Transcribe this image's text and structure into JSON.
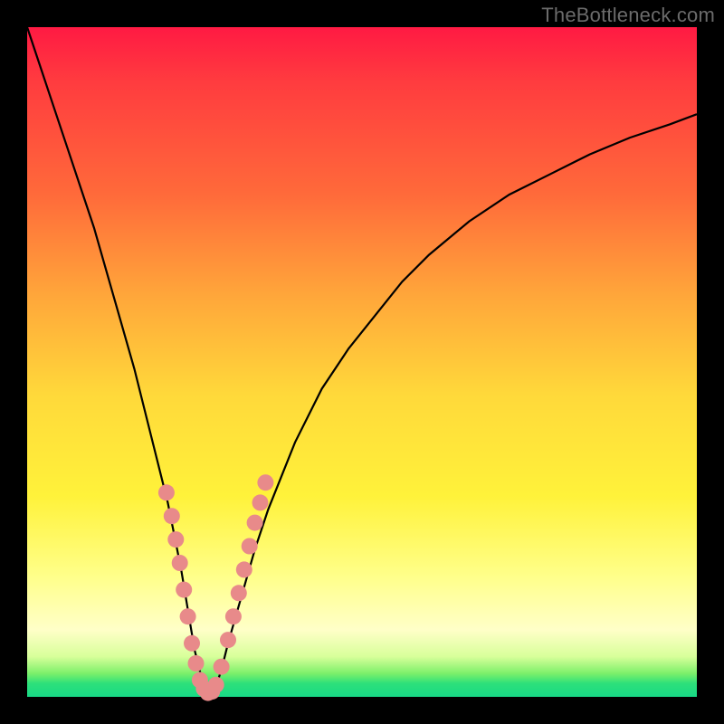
{
  "watermark": "TheBottleneck.com",
  "colors": {
    "frame": "#000000",
    "curve": "#000000",
    "marker_fill": "#e88a8a",
    "marker_stroke": "#d87575"
  },
  "chart_data": {
    "type": "line",
    "title": "",
    "xlabel": "",
    "ylabel": "",
    "xlim": [
      0,
      100
    ],
    "ylim": [
      0,
      100
    ],
    "series": [
      {
        "name": "bottleneck-curve",
        "x": [
          0,
          2,
          4,
          6,
          8,
          10,
          12,
          14,
          16,
          18,
          20,
          21,
          22,
          23,
          24,
          25,
          26,
          27,
          27.5,
          28,
          29,
          30,
          32,
          34,
          36,
          38,
          40,
          44,
          48,
          52,
          56,
          60,
          66,
          72,
          78,
          84,
          90,
          96,
          100
        ],
        "y": [
          100,
          94,
          88,
          82,
          76,
          70,
          63,
          56,
          49,
          41,
          33,
          29,
          24,
          19,
          13,
          7,
          3,
          0.8,
          0.5,
          1,
          4,
          8,
          15,
          22,
          28,
          33,
          38,
          46,
          52,
          57,
          62,
          66,
          71,
          75,
          78,
          81,
          83.5,
          85.5,
          87
        ]
      }
    ],
    "markers": {
      "name": "highlight-points",
      "x": [
        20.8,
        21.6,
        22.2,
        22.8,
        23.4,
        24.0,
        24.6,
        25.2,
        25.8,
        26.4,
        27.0,
        27.6,
        28.2,
        29.0,
        30.0,
        30.8,
        31.6,
        32.4,
        33.2,
        34.0,
        34.8,
        35.6
      ],
      "y": [
        30.5,
        27.0,
        23.5,
        20.0,
        16.0,
        12.0,
        8.0,
        5.0,
        2.5,
        1.2,
        0.6,
        0.8,
        1.8,
        4.5,
        8.5,
        12.0,
        15.5,
        19.0,
        22.5,
        26.0,
        29.0,
        32.0
      ]
    }
  }
}
